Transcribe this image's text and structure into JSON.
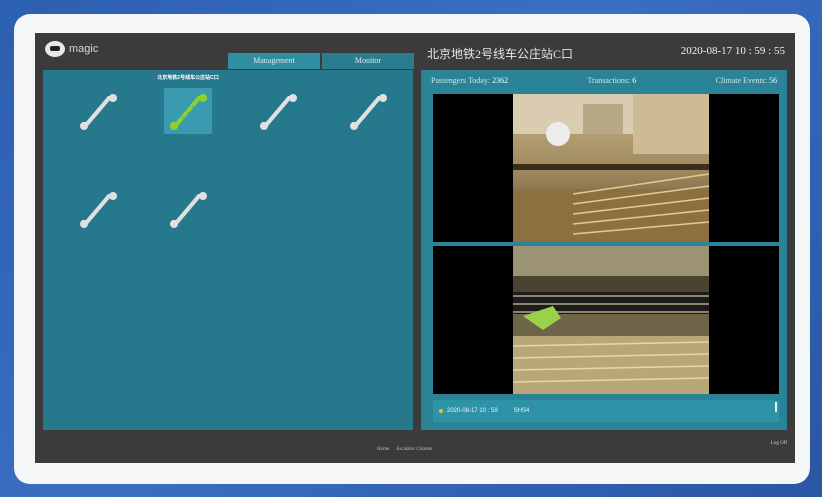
{
  "header": {
    "logo_line1": "magic",
    "logo_line2": "",
    "station_title": "北京地铁2号线车公庄站C口",
    "datetime": "2020-08-17 10 : 59 : 55"
  },
  "tabs": [
    {
      "label": "Management"
    },
    {
      "label": "Monitor"
    }
  ],
  "devices": [
    {
      "label": "",
      "selected": false
    },
    {
      "label": "北京地铁2号线车公庄站C口",
      "selected": true
    },
    {
      "label": "",
      "selected": false
    },
    {
      "label": "",
      "selected": false
    },
    {
      "label": "",
      "selected": false
    },
    {
      "label": "",
      "selected": false
    }
  ],
  "stats": {
    "passengers_label": "Passengers Today:",
    "passengers_value": "2362",
    "transactions_label": "Transactions:",
    "transactions_value": "6",
    "climate_label": "Climate Events:",
    "climate_value": "56"
  },
  "timeline": {
    "timestamp": "2020-08-17 10 : 59",
    "code": "SHS4"
  },
  "footer": {
    "link1": "Home",
    "link2": "Escalator Climate",
    "logoff": "Log Off"
  },
  "colors": {
    "panel": "#26798c",
    "accent": "#e6c22a",
    "selected_icon": "#8ed12c",
    "icon": "#e0e0e0"
  }
}
